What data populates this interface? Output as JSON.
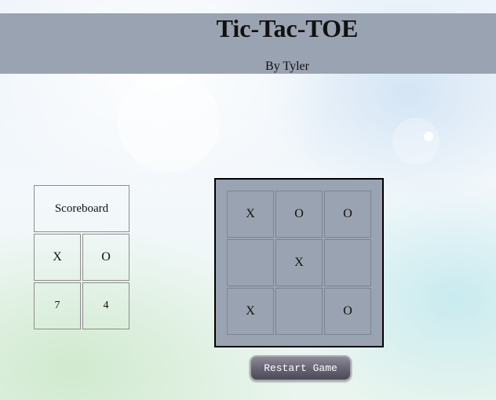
{
  "header": {
    "title": "Tic-Tac-TOE",
    "subtitle": "By Tyler"
  },
  "scoreboard": {
    "title": "Scoreboard",
    "players": [
      {
        "symbol": "X",
        "score": "7"
      },
      {
        "symbol": "O",
        "score": "4"
      }
    ]
  },
  "board": {
    "cells": [
      "X",
      "O",
      "O",
      "",
      "X",
      "",
      "X",
      "",
      "O"
    ]
  },
  "controls": {
    "restart_label": "Restart Game"
  },
  "colors": {
    "header_bg": "#9aa3b1",
    "board_bg": "#9aa3b1",
    "button_bg": "#6b6878"
  }
}
